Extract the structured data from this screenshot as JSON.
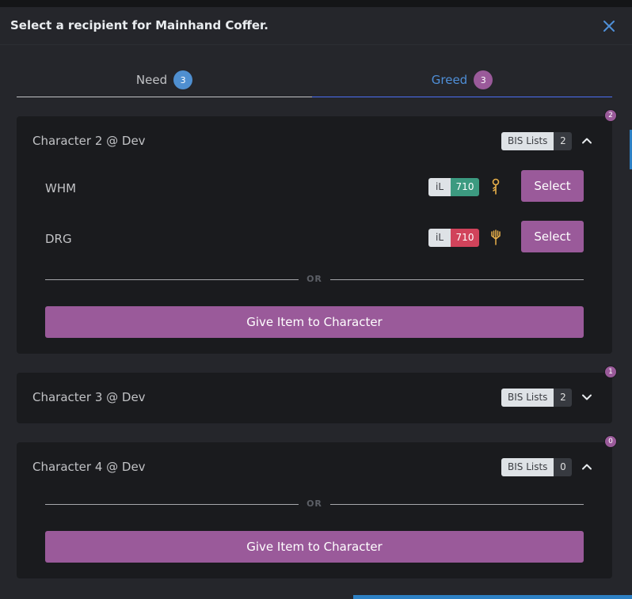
{
  "modal": {
    "title": "Select a recipient for Mainhand Coffer."
  },
  "tabs": [
    {
      "label": "Need",
      "count": "3",
      "active": false
    },
    {
      "label": "Greed",
      "count": "3",
      "active": true
    }
  ],
  "colors": {
    "accent_purple": "#9a5a9a",
    "accent_blue": "#4f8fd8",
    "il_green": "#3c9a80",
    "il_red": "#d1435b"
  },
  "cards": [
    {
      "character": "Character 2 @ Dev",
      "count_badge": "2",
      "bis_label": "BIS Lists",
      "bis_count": "2",
      "expanded": true,
      "jobs": [
        {
          "name": "WHM",
          "il_label": "iL",
          "il_value": "710",
          "icon": "whm-staff-icon",
          "select_label": "Select"
        },
        {
          "name": "DRG",
          "il_label": "iL",
          "il_value": "710",
          "icon": "drg-lance-icon",
          "select_label": "Select"
        }
      ],
      "or_label": "OR",
      "give_label": "Give Item to Character"
    },
    {
      "character": "Character 3 @ Dev",
      "count_badge": "1",
      "bis_label": "BIS Lists",
      "bis_count": "2",
      "expanded": false
    },
    {
      "character": "Character 4 @ Dev",
      "count_badge": "0",
      "bis_label": "BIS Lists",
      "bis_count": "0",
      "expanded": true,
      "or_label": "OR",
      "give_label": "Give Item to Character"
    }
  ]
}
